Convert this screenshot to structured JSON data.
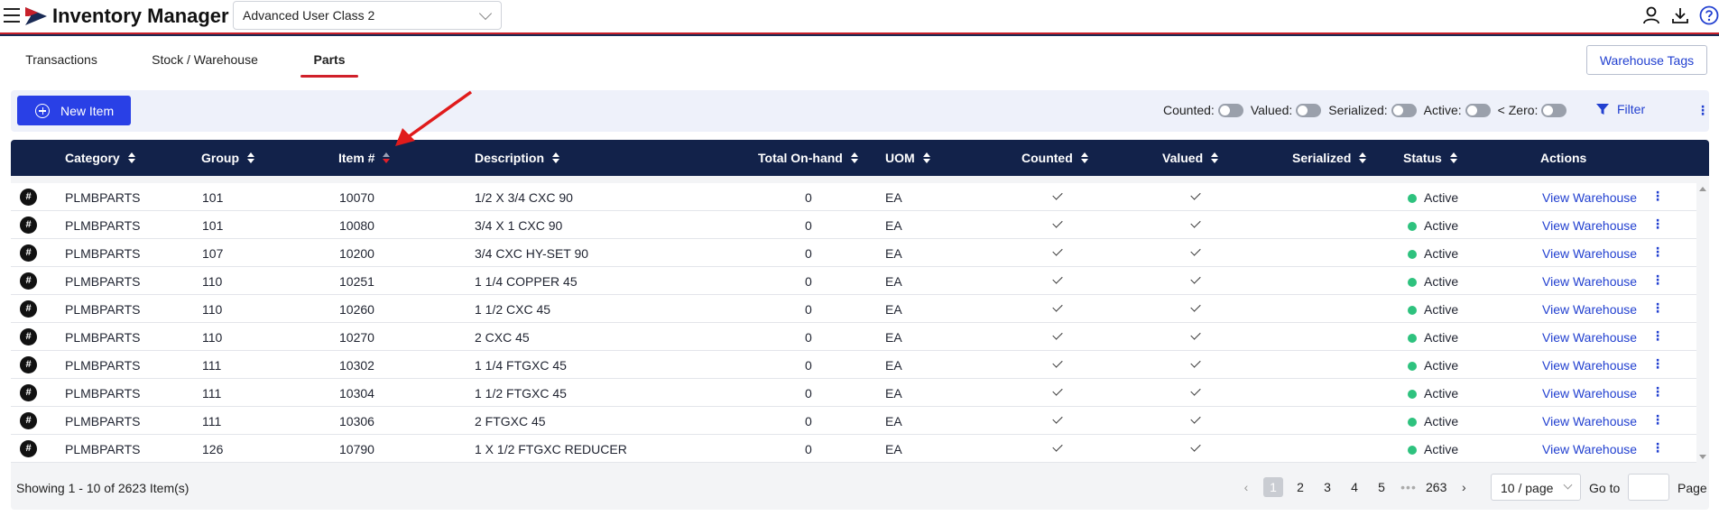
{
  "header": {
    "app_title": "Inventory Manager",
    "user_class": "Advanced User Class 2"
  },
  "tabs": [
    {
      "label": "Transactions",
      "active": false
    },
    {
      "label": "Stock / Warehouse",
      "active": false
    },
    {
      "label": "Parts",
      "active": true
    }
  ],
  "warehouse_tags_label": "Warehouse Tags",
  "toolbar": {
    "new_item_label": "New Item",
    "toggles": [
      {
        "label": "Counted:",
        "on": false
      },
      {
        "label": "Valued:",
        "on": false
      },
      {
        "label": "Serialized:",
        "on": false
      },
      {
        "label": "Active:",
        "on": false
      },
      {
        "label": "< Zero:",
        "on": false
      }
    ],
    "filter_label": "Filter"
  },
  "table": {
    "columns": [
      "Category",
      "Group",
      "Item #",
      "Description",
      "Total On-hand",
      "UOM",
      "Counted",
      "Valued",
      "Serialized",
      "Status",
      "Actions"
    ],
    "sorted_column": "Item #",
    "rows": [
      {
        "badge": "#",
        "category": "PLMBPARTS",
        "group": "101",
        "item": "10070",
        "description": "1/2 X 3/4 CXC 90",
        "onhand": "0",
        "uom": "EA",
        "counted": true,
        "valued": true,
        "status": "Active",
        "action": "View Warehouse"
      },
      {
        "badge": "#",
        "category": "PLMBPARTS",
        "group": "101",
        "item": "10080",
        "description": "3/4 X 1 CXC 90",
        "onhand": "0",
        "uom": "EA",
        "counted": true,
        "valued": true,
        "status": "Active",
        "action": "View Warehouse"
      },
      {
        "badge": "#",
        "category": "PLMBPARTS",
        "group": "107",
        "item": "10200",
        "description": "3/4 CXC HY-SET 90",
        "onhand": "0",
        "uom": "EA",
        "counted": true,
        "valued": true,
        "status": "Active",
        "action": "View Warehouse"
      },
      {
        "badge": "#",
        "category": "PLMBPARTS",
        "group": "110",
        "item": "10251",
        "description": "1 1/4 COPPER 45",
        "onhand": "0",
        "uom": "EA",
        "counted": true,
        "valued": true,
        "status": "Active",
        "action": "View Warehouse"
      },
      {
        "badge": "#",
        "category": "PLMBPARTS",
        "group": "110",
        "item": "10260",
        "description": "1 1/2 CXC 45",
        "onhand": "0",
        "uom": "EA",
        "counted": true,
        "valued": true,
        "status": "Active",
        "action": "View Warehouse"
      },
      {
        "badge": "#",
        "category": "PLMBPARTS",
        "group": "110",
        "item": "10270",
        "description": "2 CXC 45",
        "onhand": "0",
        "uom": "EA",
        "counted": true,
        "valued": true,
        "status": "Active",
        "action": "View Warehouse"
      },
      {
        "badge": "#",
        "category": "PLMBPARTS",
        "group": "111",
        "item": "10302",
        "description": "1 1/4 FTGXC 45",
        "onhand": "0",
        "uom": "EA",
        "counted": true,
        "valued": true,
        "status": "Active",
        "action": "View Warehouse"
      },
      {
        "badge": "#",
        "category": "PLMBPARTS",
        "group": "111",
        "item": "10304",
        "description": "1 1/2 FTGXC 45",
        "onhand": "0",
        "uom": "EA",
        "counted": true,
        "valued": true,
        "status": "Active",
        "action": "View Warehouse"
      },
      {
        "badge": "#",
        "category": "PLMBPARTS",
        "group": "111",
        "item": "10306",
        "description": "2 FTGXC 45",
        "onhand": "0",
        "uom": "EA",
        "counted": true,
        "valued": true,
        "status": "Active",
        "action": "View Warehouse"
      },
      {
        "badge": "#",
        "category": "PLMBPARTS",
        "group": "126",
        "item": "10790",
        "description": "1 X 1/2 FTGXC REDUCER",
        "onhand": "0",
        "uom": "EA",
        "counted": true,
        "valued": true,
        "status": "Active",
        "action": "View Warehouse"
      }
    ]
  },
  "footer": {
    "showing": "Showing 1 - 10 of 2623 Item(s)",
    "pages": [
      "1",
      "2",
      "3",
      "4",
      "5"
    ],
    "dots": "•••",
    "last_page": "263",
    "current_page": "1",
    "per_page": "10 / page",
    "goto_label": "Go to",
    "page_label": "Page"
  },
  "colors": {
    "primary": "#2940e6",
    "header_bg": "#12224a",
    "accent_red": "#d0202a",
    "status_active": "#2ec27e"
  }
}
